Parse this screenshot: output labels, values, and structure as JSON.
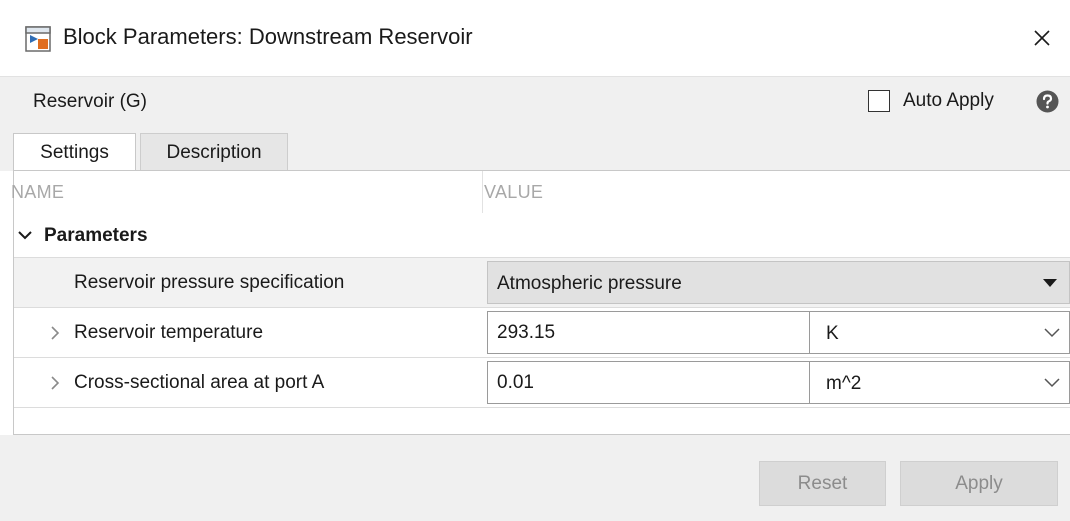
{
  "window": {
    "title": "Block Parameters: Downstream Reservoir",
    "app_icon": "simulink-block-icon",
    "close_icon": "close-icon"
  },
  "header": {
    "block_type": "Reservoir (G)",
    "auto_apply_label": "Auto Apply",
    "auto_apply_checked": false,
    "help_icon": "help-icon"
  },
  "tabs": [
    {
      "label": "Settings",
      "active": true
    },
    {
      "label": "Description",
      "active": false
    }
  ],
  "table": {
    "name_header": "NAME",
    "value_header": "VALUE",
    "group": {
      "label": "Parameters",
      "expanded": true
    },
    "rows": [
      {
        "label": "Reservoir pressure specification",
        "value": "Atmospheric pressure",
        "type": "dropdown"
      },
      {
        "label": "Reservoir temperature",
        "value": "293.15",
        "unit": "K",
        "type": "value-unit"
      },
      {
        "label": "Cross-sectional area at port A",
        "value": "0.01",
        "unit": "m^2",
        "type": "value-unit"
      }
    ]
  },
  "footer": {
    "reset_label": "Reset",
    "apply_label": "Apply"
  },
  "colors": {
    "panel_bg": "#f0f0f0",
    "disabled_button_text": "#8c8c8c",
    "header_text_muted": "#a8a8a8"
  }
}
